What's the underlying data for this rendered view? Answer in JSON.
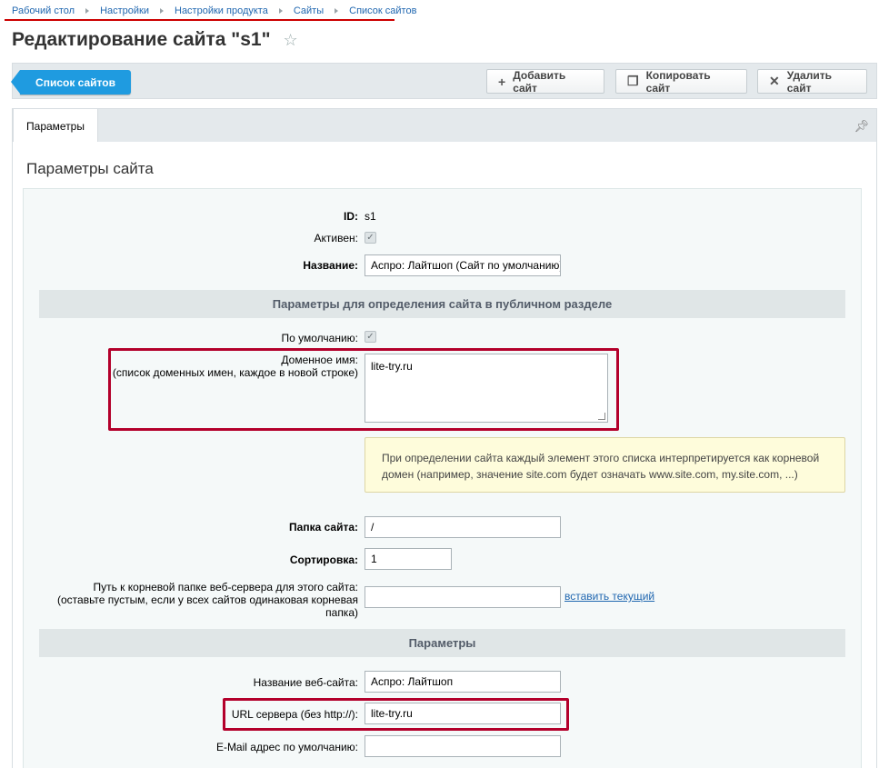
{
  "breadcrumb": [
    "Рабочий стол",
    "Настройки",
    "Настройки продукта",
    "Сайты",
    "Список сайтов"
  ],
  "page_title": "Редактирование сайта \"s1\"",
  "toolbar": {
    "back_label": "Список сайтов",
    "add_label": "Добавить сайт",
    "copy_label": "Копировать сайт",
    "delete_label": "Удалить сайт"
  },
  "tabs": [
    {
      "label": "Параметры"
    }
  ],
  "section_title": "Параметры сайта",
  "fields": {
    "id_label": "ID:",
    "id_value": "s1",
    "active_label": "Активен:",
    "name_label": "Название:",
    "name_value": "Аспро: Лайтшоп (Сайт по умолчанию)",
    "public_section_heading": "Параметры для определения сайта в публичном разделе",
    "default_label": "По умолчанию:",
    "domain_label_line1": "Доменное имя:",
    "domain_label_line2": "(список доменных имен, каждое в новой строке)",
    "domain_value": "lite-try.ru",
    "note_text": "При определении сайта каждый элемент этого списка интерпретируется как корневой домен (например, значение site.com будет означать www.site.com, my.site.com, ...)",
    "folder_label": "Папка сайта:",
    "folder_value": "/",
    "sort_label": "Сортировка:",
    "sort_value": "1",
    "docroot_label_line1": "Путь к корневой папке веб-сервера для этого сайта:",
    "docroot_label_line2": "(оставьте пустым, если у всех сайтов одинаковая корневая",
    "docroot_label_line3": "папка)",
    "docroot_value": "",
    "insert_current_link": "вставить текущий",
    "params_heading": "Параметры",
    "site_name_label": "Название веб-сайта:",
    "site_name_value": "Аспро: Лайтшоп",
    "server_url_label": "URL сервера (без http://):",
    "server_url_value": "lite-try.ru",
    "email_label": "E-Mail адрес по умолчанию:",
    "email_value": ""
  },
  "colors": {
    "accent": "#1f9be0",
    "link": "#2067b0",
    "highlight": "#b3002b"
  }
}
